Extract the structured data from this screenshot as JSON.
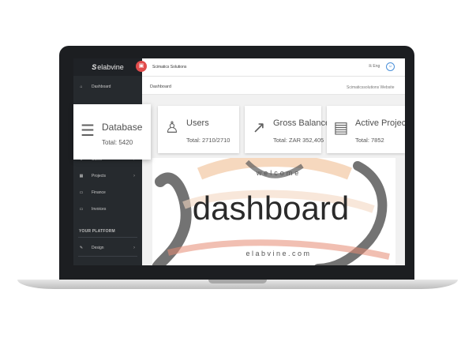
{
  "app": {
    "brand": "elabvine",
    "top_title": "Scimatics Solutions"
  },
  "topbar": {
    "menu_icon": "grid-icon",
    "language": "Eng",
    "user_icon": "user-circle-icon"
  },
  "page": {
    "title": "Dashboard",
    "link": "Scimaticssolutions Website"
  },
  "sidebar": {
    "items": [
      {
        "label": "Dashboard",
        "icon": "home-icon",
        "chevron": false
      },
      {
        "label": "Users",
        "icon": "users-icon",
        "chevron": true
      },
      {
        "label": "Projects",
        "icon": "grid-icon",
        "chevron": true
      },
      {
        "label": "Finance",
        "icon": "money-icon",
        "chevron": false
      },
      {
        "label": "Invoices",
        "icon": "invoice-icon",
        "chevron": false
      }
    ],
    "heading": "YOUR PLATFORM",
    "platform_items": [
      {
        "label": "Design",
        "icon": "brush-icon",
        "chevron": true
      }
    ]
  },
  "stats": [
    {
      "title": "Database",
      "value": "Total: 5420",
      "icon": "database-icon"
    },
    {
      "title": "Users",
      "value": "Total: 2710/2710",
      "icon": "user-icon"
    },
    {
      "title": "Gross Balance",
      "value": "Total: ZAR 352,405",
      "icon": "trend-up-icon"
    },
    {
      "title": "Active Projects",
      "value": "Total: 7852",
      "icon": "briefcase-icon"
    }
  ],
  "hero": {
    "welcome": "welcome",
    "headline": "dashboard",
    "domain": "elabvine.com"
  },
  "colors": {
    "sidebar": "#262a2e",
    "accent": "#e14c4c",
    "user_icon": "#4a90d9",
    "bezel": "#1c1e21"
  }
}
